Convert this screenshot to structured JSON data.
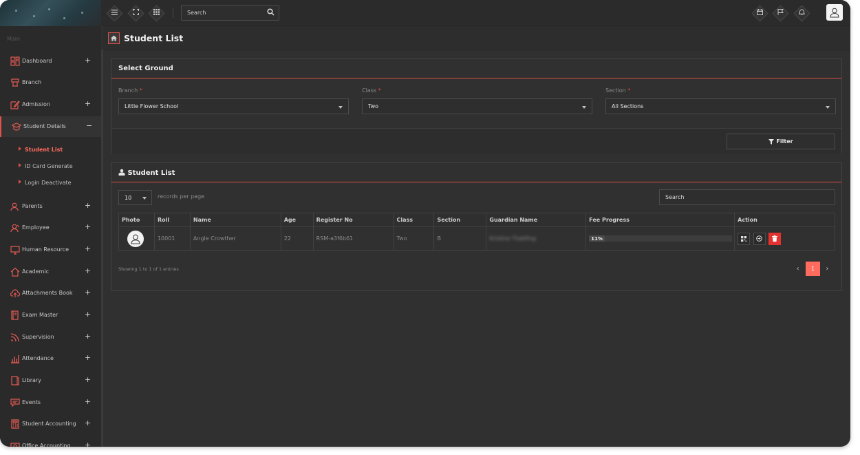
{
  "topbar": {
    "search_placeholder": "Search",
    "icons": [
      "menu-icon",
      "fullscreen-icon",
      "apps-grid-icon",
      "calendar-icon",
      "flag-icon",
      "bell-icon",
      "user-avatar-icon"
    ]
  },
  "sidebar": {
    "heading": "Main",
    "items": [
      {
        "label": "Dashboard",
        "icon": "dashboard-icon",
        "expand": "+"
      },
      {
        "label": "Branch",
        "icon": "branch-icon",
        "expand": ""
      },
      {
        "label": "Admission",
        "icon": "edit-icon",
        "expand": "+"
      },
      {
        "label": "Student Details",
        "icon": "graduation-cap-icon",
        "expand": "−"
      },
      {
        "label": "Parents",
        "icon": "parents-icon",
        "expand": "+"
      },
      {
        "label": "Employee",
        "icon": "employee-icon",
        "expand": "+"
      },
      {
        "label": "Human Resource",
        "icon": "monitor-icon",
        "expand": "+"
      },
      {
        "label": "Academic",
        "icon": "home-icon",
        "expand": "+"
      },
      {
        "label": "Attachments Book",
        "icon": "cloud-upload-icon",
        "expand": "+"
      },
      {
        "label": "Exam Master",
        "icon": "book-icon",
        "expand": "+"
      },
      {
        "label": "Supervision",
        "icon": "rss-icon",
        "expand": "+"
      },
      {
        "label": "Attendance",
        "icon": "bar-chart-icon",
        "expand": "+"
      },
      {
        "label": "Library",
        "icon": "library-icon",
        "expand": "+"
      },
      {
        "label": "Events",
        "icon": "chat-icon",
        "expand": "+"
      },
      {
        "label": "Student Accounting",
        "icon": "calculator-icon",
        "expand": "+"
      },
      {
        "label": "Office Accounting",
        "icon": "money-icon",
        "expand": "+"
      }
    ],
    "subitems": [
      {
        "label": "Student List",
        "active": true
      },
      {
        "label": "ID Card Generate",
        "active": false
      },
      {
        "label": "Login Deactivate",
        "active": false
      }
    ]
  },
  "page": {
    "title": "Student List"
  },
  "select_ground": {
    "title": "Select Ground",
    "branch_label": "Branch",
    "branch_value": "Little Flower School",
    "class_label": "Class",
    "class_value": "Two",
    "section_label": "Section",
    "section_value": "All Sections",
    "required_mark": "*",
    "filter_label": "Filter"
  },
  "student_list": {
    "title": "Student List",
    "records_per_page": "10",
    "records_label": "records per page",
    "search_placeholder": "Search",
    "columns": [
      "Photo",
      "Roll",
      "Name",
      "Age",
      "Register No",
      "Class",
      "Section",
      "Guardian Name",
      "Fee Progress",
      "Action"
    ],
    "rows": [
      {
        "roll": "10001",
        "name": "Angle Crowther",
        "age": "22",
        "register_no": "RSM-a3f6b61",
        "class": "Two",
        "section": "B",
        "guardian_name": "Kristina Thakfing",
        "fee_progress": "11%",
        "fee_fraction": 0.11
      }
    ],
    "showing": "Showing 1 to 1 of 1 entries",
    "pagination": {
      "prev": "‹",
      "current": "1",
      "next": "›"
    }
  },
  "colors": {
    "accent": "#e0514a",
    "danger": "#e3322f",
    "page_current": "#ff6b5e"
  }
}
